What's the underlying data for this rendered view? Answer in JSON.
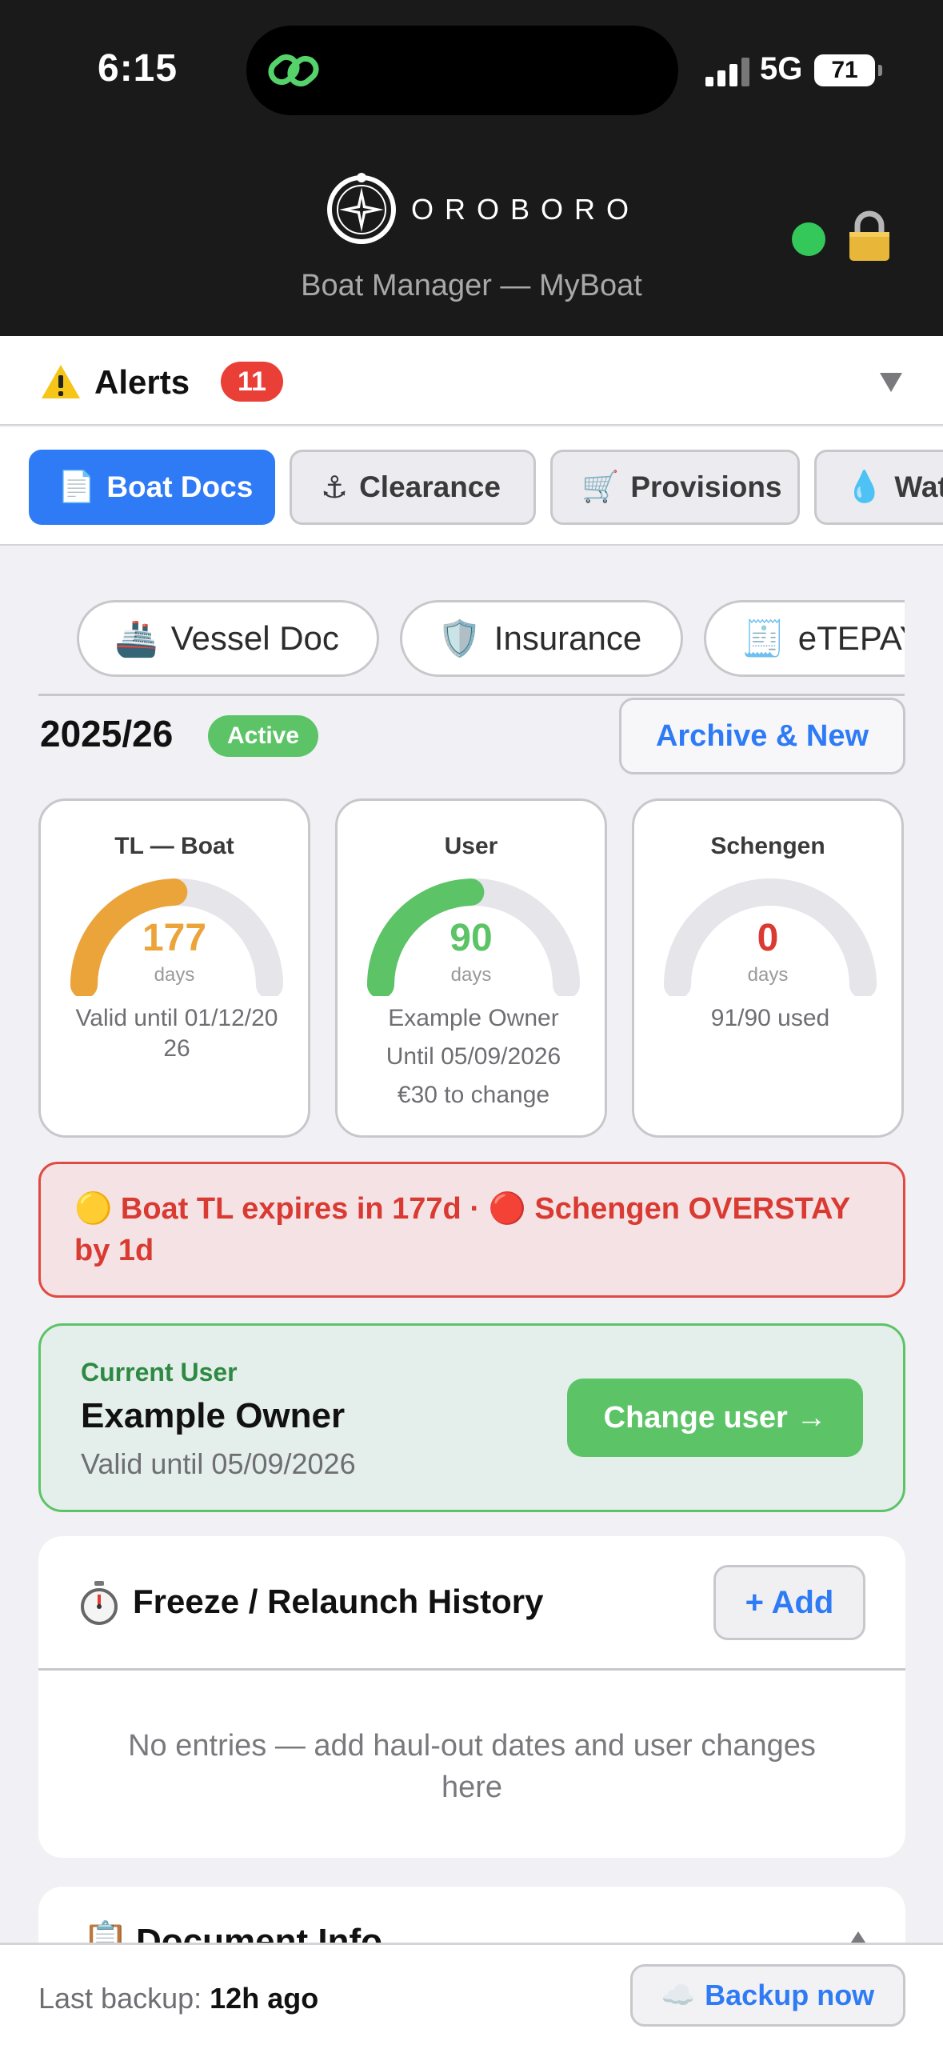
{
  "status_bar": {
    "time": "6:15",
    "network": "5G",
    "battery": "71"
  },
  "header": {
    "brand": "OROBORO",
    "subtitle": "Boat Manager — MyBoat"
  },
  "alerts": {
    "label": "Alerts",
    "count": "11"
  },
  "tabs": [
    {
      "label": "Boat Docs",
      "icon": "page-icon",
      "glyph": "📄",
      "active": true
    },
    {
      "label": "Clearance",
      "icon": "anchor-icon",
      "glyph": "⚓",
      "active": false
    },
    {
      "label": "Provisions",
      "icon": "cart-icon",
      "glyph": "🛒",
      "active": false
    },
    {
      "label": "Wat",
      "icon": "water-drop-icon",
      "glyph": "💧",
      "active": false
    }
  ],
  "subtabs": [
    {
      "label": "Vessel Doc",
      "icon": "ship-icon",
      "glyph": "🚢"
    },
    {
      "label": "Insurance",
      "icon": "shield-icon",
      "glyph": "🛡️"
    },
    {
      "label": "eTEPAY",
      "icon": "receipt-icon",
      "glyph": "🧾"
    }
  ],
  "year": {
    "label": "2025/26",
    "badge": "Active",
    "archive_button": "Archive & New"
  },
  "gauges": [
    {
      "title": "TL — Boat",
      "value": "177",
      "unit": "days",
      "fill": 0.49,
      "color": "#eba43a",
      "lines": [
        "Valid until 01/12/20",
        "26"
      ]
    },
    {
      "title": "User",
      "value": "90",
      "unit": "days",
      "fill": 0.49,
      "color": "#5cc467",
      "lines": [
        "Example Owner",
        "Until 05/09/2026",
        "€30 to change"
      ]
    },
    {
      "title": "Schengen",
      "value": "0",
      "unit": "days",
      "fill": 0,
      "color": "#d93a32",
      "lines": [
        "91/90 used"
      ]
    }
  ],
  "warning": {
    "text": "🟡 Boat TL expires in 177d · 🔴 Schengen OVERSTAY by 1d"
  },
  "current_user": {
    "caption": "Current User",
    "name": "Example Owner",
    "valid": "Valid until 05/09/2026",
    "button": "Change user →"
  },
  "history": {
    "title": "Freeze / Relaunch History",
    "add_button": "+ Add",
    "empty": "No entries — add haul-out dates and user changes here"
  },
  "doc_info": {
    "title": "Document Info"
  },
  "footer": {
    "backup_label": "Last backup:",
    "backup_value": "12h ago",
    "backup_button": "Backup now"
  },
  "colors": {
    "accent": "#2f7bf5",
    "success": "#5cc467",
    "danger": "#ea3f36",
    "warning": "#eba43a"
  }
}
